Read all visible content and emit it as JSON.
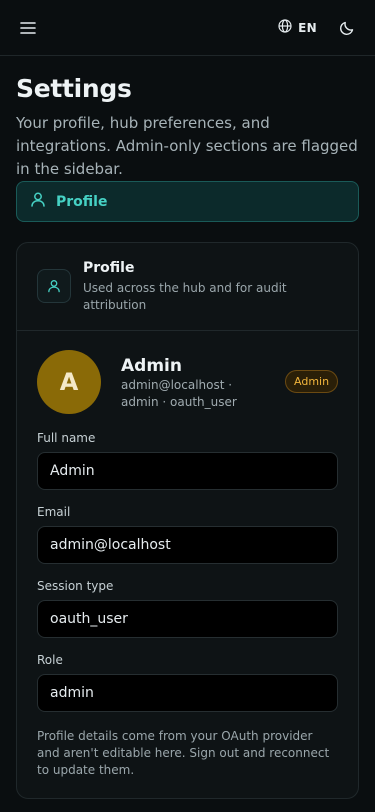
{
  "topbar": {
    "menu_icon": "hamburger-menu-icon",
    "language_icon": "globe-icon",
    "language_label": "EN",
    "theme_icon": "moon-icon"
  },
  "page": {
    "title": "Settings",
    "subtitle": "Your profile, hub preferences, and integrations. Admin-only sections are flagged in the sidebar."
  },
  "nav": {
    "active_section": {
      "label": "Profile",
      "icon": "user-icon"
    }
  },
  "card": {
    "title": "Profile",
    "description": "Used across the hub and for audit attribution",
    "icon": "user-icon",
    "user": {
      "avatar_initial": "A",
      "name": "Admin",
      "meta": "admin@localhost · admin · oauth_user",
      "badge": "Admin"
    },
    "fields": [
      {
        "label": "Full name",
        "value": "Admin"
      },
      {
        "label": "Email",
        "value": "admin@localhost"
      },
      {
        "label": "Session type",
        "value": "oauth_user"
      },
      {
        "label": "Role",
        "value": "admin"
      }
    ],
    "note": "Profile details come from your OAuth provider and aren't editable here. Sign out and reconnect to update them."
  },
  "colors": {
    "accent": "#46d1c4",
    "background": "#0a0e10",
    "avatar": "#8a6a07",
    "badge_text": "#f0b43c"
  }
}
